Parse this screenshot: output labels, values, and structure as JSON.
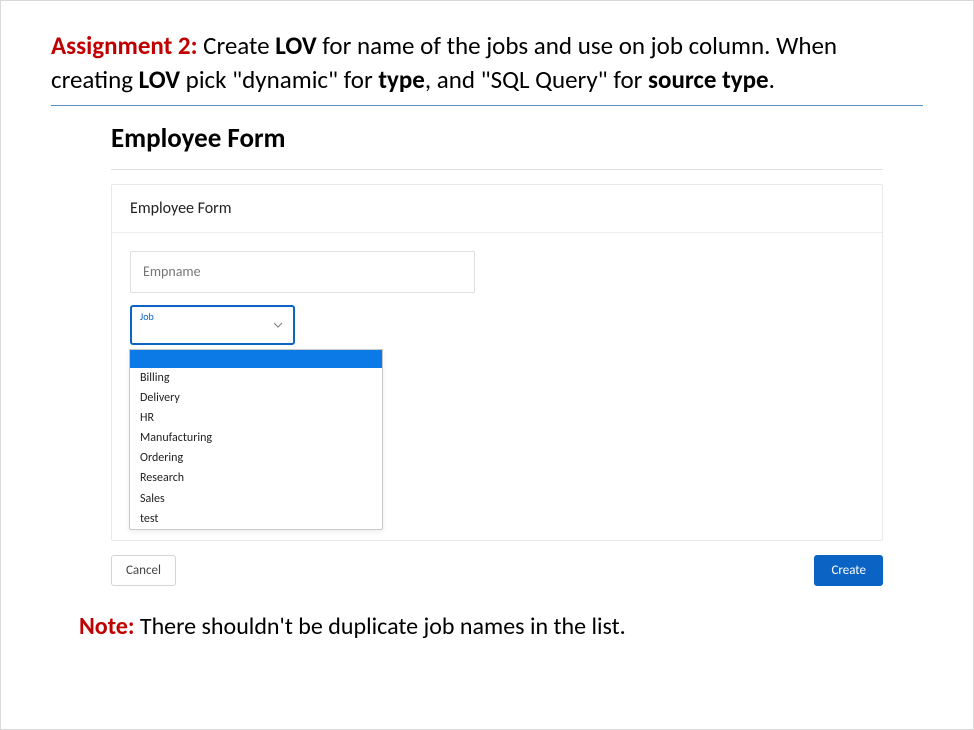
{
  "assignment": {
    "label": "Assignment 2:",
    "p1_part1": " Create ",
    "p1_bold1": "LOV",
    "p1_part2": " for name of the jobs and use on job column. When creating ",
    "p1_bold2": "LOV",
    "p1_part3": " pick \"dynamic\" for ",
    "p1_bold3": "type",
    "p1_part4": ", and \"SQL Query\" for ",
    "p1_bold4": "source type",
    "p1_part5": "."
  },
  "form": {
    "title": "Employee Form",
    "card_header": "Employee Form",
    "empname_placeholder": "Empname",
    "job_label": "Job",
    "dropdown_options": [
      "",
      "Billing",
      "Delivery",
      "HR",
      "Manufacturing",
      "Ordering",
      "Research",
      "Sales",
      "test"
    ],
    "cancel_label": "Cancel",
    "create_label": "Create"
  },
  "note": {
    "label": "Note:",
    "text": " There shouldn't be duplicate job names in the list."
  }
}
